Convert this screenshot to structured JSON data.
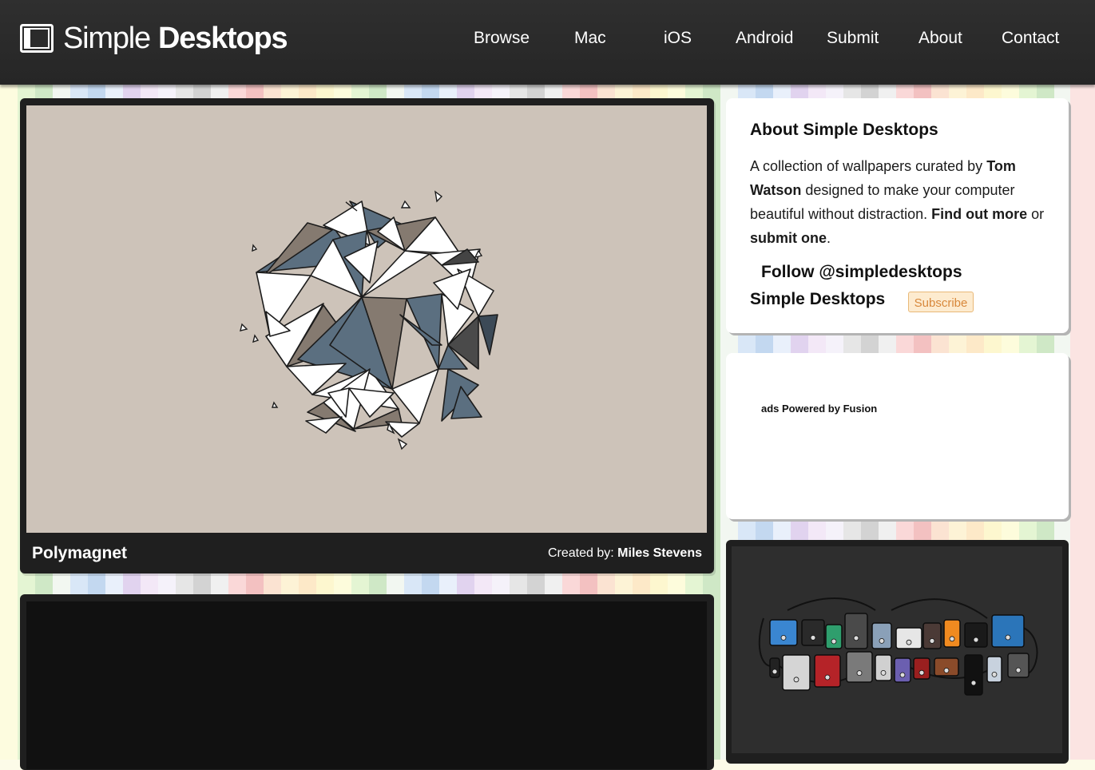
{
  "header": {
    "logo": {
      "light": "Simple",
      "bold": "Desktops"
    },
    "nav": [
      {
        "label": "Browse"
      },
      {
        "label": "Mac"
      },
      {
        "label": "iOS"
      },
      {
        "label": "Android"
      },
      {
        "label": "Submit"
      },
      {
        "label": "About"
      },
      {
        "label": "Contact"
      }
    ]
  },
  "featured": {
    "title": "Polymagnet",
    "credit_prefix": "Created by:",
    "author": "Miles Stevens",
    "colors": {
      "background": "#cdc3b9",
      "slate": "#5b6f80",
      "taupe": "#857a70",
      "outline": "#1c1c1c"
    }
  },
  "sidebar": {
    "about": {
      "title": "About Simple Desktops",
      "text_1": "A collection of wallpapers curated by",
      "curator": "Tom Watson",
      "text_2": "designed to make your computer beautiful without distraction.",
      "link_more": "Find out more",
      "text_or": "or",
      "link_submit": "submit one",
      "text_end": "."
    },
    "follow": "Follow @simpledesktops",
    "feed_label": "Simple Desktops",
    "subscribe_label": "Subscribe",
    "ad_label": "ads Powered by Fusion"
  },
  "theme": {
    "accent": "#d8883b",
    "header_bg": "#2a2a2a",
    "card_dark": "#1f1f1f"
  }
}
